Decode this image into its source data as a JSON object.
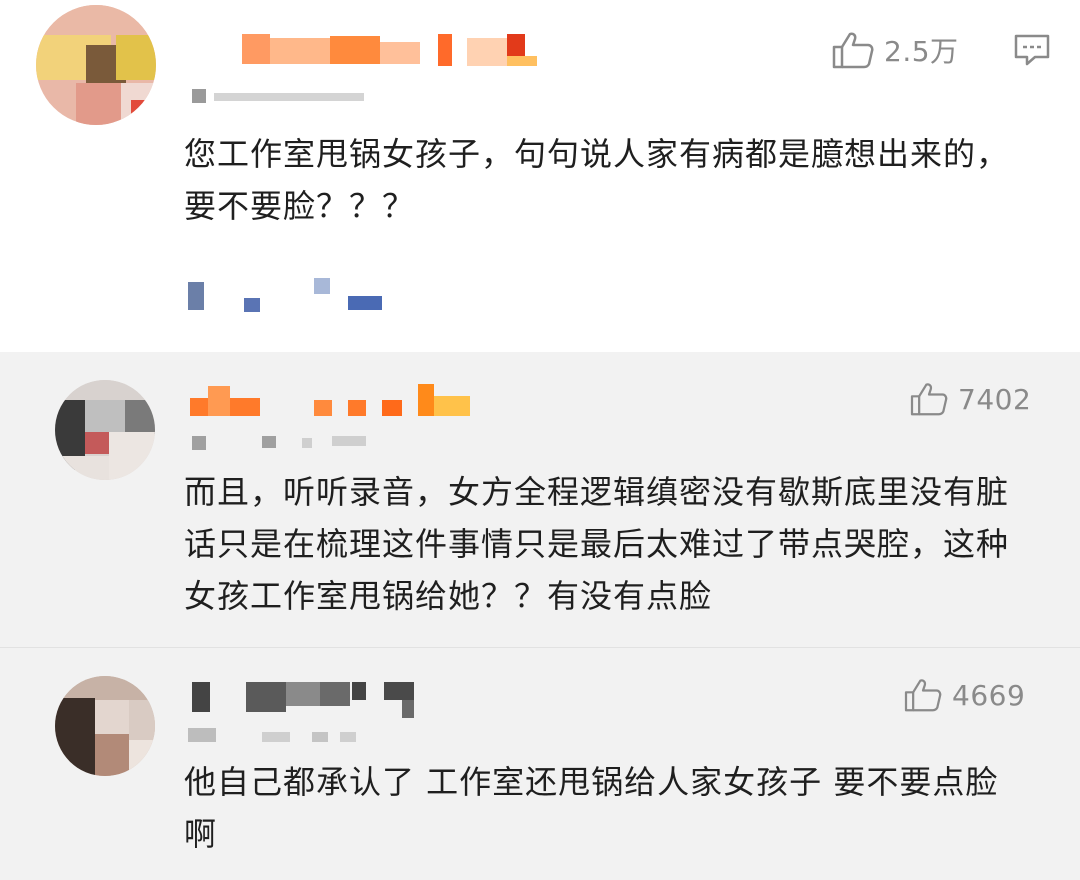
{
  "comments": [
    {
      "likes": "2.5万",
      "text": "您工作室甩锅女孩子，句句说人家有病都是臆想出来的，要不要脸？？？"
    },
    {
      "likes": "7402",
      "text": "而且，听听录音，女方全程逻辑缜密没有歇斯底里没有脏话只是在梳理这件事情只是最后太难过了带点哭腔，这种女孩工作室甩锅给她？？有没有点脸"
    },
    {
      "likes": "4669",
      "text": "他自己都承认了 工作室还甩锅给人家女孩子 要不要点脸啊"
    }
  ],
  "icons": {
    "like": "thumbs-up-icon",
    "reply": "comment-icon"
  },
  "colors": {
    "like_gray": "#8a8a8a",
    "pixel_orange": "#ff8a3d"
  }
}
